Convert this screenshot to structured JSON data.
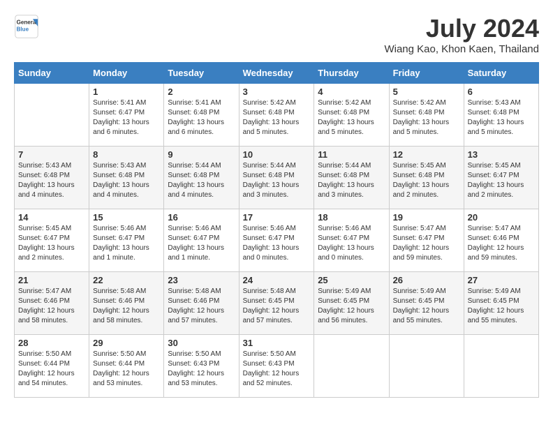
{
  "header": {
    "logo_line1": "General",
    "logo_line2": "Blue",
    "month": "July 2024",
    "location": "Wiang Kao, Khon Kaen, Thailand"
  },
  "weekdays": [
    "Sunday",
    "Monday",
    "Tuesday",
    "Wednesday",
    "Thursday",
    "Friday",
    "Saturday"
  ],
  "weeks": [
    [
      {
        "day": null
      },
      {
        "day": 1,
        "sunrise": "5:41 AM",
        "sunset": "6:47 PM",
        "daylight": "13 hours and 6 minutes."
      },
      {
        "day": 2,
        "sunrise": "5:41 AM",
        "sunset": "6:48 PM",
        "daylight": "13 hours and 6 minutes."
      },
      {
        "day": 3,
        "sunrise": "5:42 AM",
        "sunset": "6:48 PM",
        "daylight": "13 hours and 5 minutes."
      },
      {
        "day": 4,
        "sunrise": "5:42 AM",
        "sunset": "6:48 PM",
        "daylight": "13 hours and 5 minutes."
      },
      {
        "day": 5,
        "sunrise": "5:42 AM",
        "sunset": "6:48 PM",
        "daylight": "13 hours and 5 minutes."
      },
      {
        "day": 6,
        "sunrise": "5:43 AM",
        "sunset": "6:48 PM",
        "daylight": "13 hours and 5 minutes."
      }
    ],
    [
      {
        "day": 7,
        "sunrise": "5:43 AM",
        "sunset": "6:48 PM",
        "daylight": "13 hours and 4 minutes."
      },
      {
        "day": 8,
        "sunrise": "5:43 AM",
        "sunset": "6:48 PM",
        "daylight": "13 hours and 4 minutes."
      },
      {
        "day": 9,
        "sunrise": "5:44 AM",
        "sunset": "6:48 PM",
        "daylight": "13 hours and 4 minutes."
      },
      {
        "day": 10,
        "sunrise": "5:44 AM",
        "sunset": "6:48 PM",
        "daylight": "13 hours and 3 minutes."
      },
      {
        "day": 11,
        "sunrise": "5:44 AM",
        "sunset": "6:48 PM",
        "daylight": "13 hours and 3 minutes."
      },
      {
        "day": 12,
        "sunrise": "5:45 AM",
        "sunset": "6:48 PM",
        "daylight": "13 hours and 2 minutes."
      },
      {
        "day": 13,
        "sunrise": "5:45 AM",
        "sunset": "6:47 PM",
        "daylight": "13 hours and 2 minutes."
      }
    ],
    [
      {
        "day": 14,
        "sunrise": "5:45 AM",
        "sunset": "6:47 PM",
        "daylight": "13 hours and 2 minutes."
      },
      {
        "day": 15,
        "sunrise": "5:46 AM",
        "sunset": "6:47 PM",
        "daylight": "13 hours and 1 minute."
      },
      {
        "day": 16,
        "sunrise": "5:46 AM",
        "sunset": "6:47 PM",
        "daylight": "13 hours and 1 minute."
      },
      {
        "day": 17,
        "sunrise": "5:46 AM",
        "sunset": "6:47 PM",
        "daylight": "13 hours and 0 minutes."
      },
      {
        "day": 18,
        "sunrise": "5:46 AM",
        "sunset": "6:47 PM",
        "daylight": "13 hours and 0 minutes."
      },
      {
        "day": 19,
        "sunrise": "5:47 AM",
        "sunset": "6:47 PM",
        "daylight": "12 hours and 59 minutes."
      },
      {
        "day": 20,
        "sunrise": "5:47 AM",
        "sunset": "6:46 PM",
        "daylight": "12 hours and 59 minutes."
      }
    ],
    [
      {
        "day": 21,
        "sunrise": "5:47 AM",
        "sunset": "6:46 PM",
        "daylight": "12 hours and 58 minutes."
      },
      {
        "day": 22,
        "sunrise": "5:48 AM",
        "sunset": "6:46 PM",
        "daylight": "12 hours and 58 minutes."
      },
      {
        "day": 23,
        "sunrise": "5:48 AM",
        "sunset": "6:46 PM",
        "daylight": "12 hours and 57 minutes."
      },
      {
        "day": 24,
        "sunrise": "5:48 AM",
        "sunset": "6:45 PM",
        "daylight": "12 hours and 57 minutes."
      },
      {
        "day": 25,
        "sunrise": "5:49 AM",
        "sunset": "6:45 PM",
        "daylight": "12 hours and 56 minutes."
      },
      {
        "day": 26,
        "sunrise": "5:49 AM",
        "sunset": "6:45 PM",
        "daylight": "12 hours and 55 minutes."
      },
      {
        "day": 27,
        "sunrise": "5:49 AM",
        "sunset": "6:45 PM",
        "daylight": "12 hours and 55 minutes."
      }
    ],
    [
      {
        "day": 28,
        "sunrise": "5:50 AM",
        "sunset": "6:44 PM",
        "daylight": "12 hours and 54 minutes."
      },
      {
        "day": 29,
        "sunrise": "5:50 AM",
        "sunset": "6:44 PM",
        "daylight": "12 hours and 53 minutes."
      },
      {
        "day": 30,
        "sunrise": "5:50 AM",
        "sunset": "6:43 PM",
        "daylight": "12 hours and 53 minutes."
      },
      {
        "day": 31,
        "sunrise": "5:50 AM",
        "sunset": "6:43 PM",
        "daylight": "12 hours and 52 minutes."
      },
      {
        "day": null
      },
      {
        "day": null
      },
      {
        "day": null
      }
    ]
  ],
  "labels": {
    "sunrise_prefix": "Sunrise:",
    "sunset_prefix": "Sunset:",
    "daylight_prefix": "Daylight:"
  }
}
